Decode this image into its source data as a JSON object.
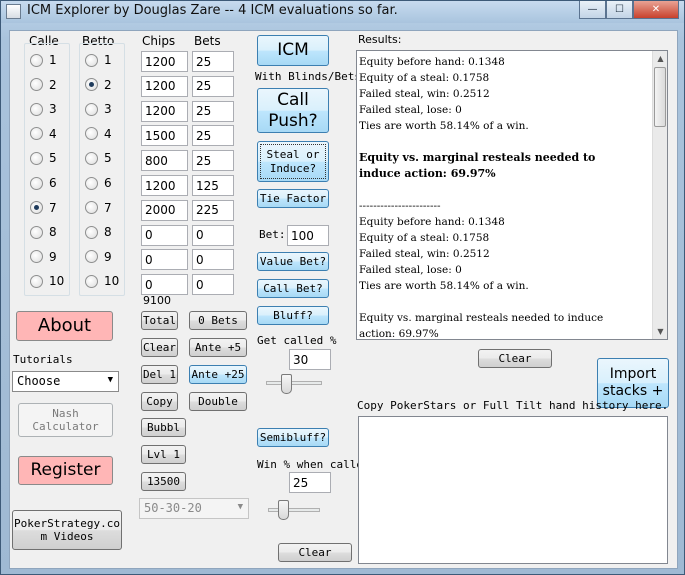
{
  "window": {
    "title": "ICM Explorer by Douglas Zare -- 4 ICM evaluations so far.",
    "controls": {
      "minimize": "—",
      "maximize": "☐",
      "close": "✕"
    }
  },
  "calle_header": "Calle",
  "betto_header": "Betto",
  "calle_options": [
    "1",
    "2",
    "3",
    "4",
    "5",
    "6",
    "7",
    "8",
    "9",
    "10"
  ],
  "calle_selected": "7",
  "betto_options": [
    "1",
    "2",
    "3",
    "4",
    "5",
    "6",
    "7",
    "8",
    "9",
    "10"
  ],
  "betto_selected": "2",
  "chips_header": "Chips",
  "bets_header": "Bets",
  "chips": [
    "1200",
    "1200",
    "1200",
    "1500",
    "800",
    "1200",
    "2000",
    "0",
    "0",
    "0"
  ],
  "bets": [
    "25",
    "25",
    "25",
    "25",
    "25",
    "125",
    "225",
    "0",
    "0",
    "0"
  ],
  "total_chips": "9100",
  "buttons": {
    "icm": "ICM",
    "with_blinds_label": "With Blinds/Bets:",
    "call_push_line1": "Call",
    "call_push_line2": "Push?",
    "steal_line1": "Steal or",
    "steal_line2": "Induce?",
    "tie_factor": "Tie Factor",
    "bet_label": "Bet:",
    "bet_value": "100",
    "value_bet": "Value Bet?",
    "call_bet": "Call Bet?",
    "bluff": "Bluff?",
    "get_called_label": "Get called %",
    "get_called_value": "30",
    "semibluff": "Semibluff?",
    "win_pct_label": "Win % when called",
    "win_pct_value": "25",
    "clear_bottom": "Clear",
    "total": "Total",
    "zero_bets": "0 Bets",
    "clear": "Clear",
    "ante5": "Ante +5",
    "del1": "Del 1",
    "ante25": "Ante +25",
    "copy": "Copy",
    "double": "Double",
    "bubbl": "Bubbl",
    "lvl1": "Lvl 1",
    "n13500": "13500",
    "payout_select": "50-30-20"
  },
  "left": {
    "about": "About",
    "tutorials_label": "Tutorials",
    "tutorials_select": "Choose",
    "nash_line1": "Nash",
    "nash_line2": "Calculator",
    "register": "Register",
    "poker_line1": "PokerStrategy.co",
    "poker_line2": "m Videos"
  },
  "results": {
    "label": "Results:",
    "lines": [
      {
        "text": "Equity before hand: 0.1348",
        "bold": false
      },
      {
        "text": "Equity of a steal: 0.1758",
        "bold": false
      },
      {
        "text": "Failed steal, win: 0.2512",
        "bold": false
      },
      {
        "text": "Failed steal, lose: 0",
        "bold": false
      },
      {
        "text": "Ties are worth 58.14% of a win.",
        "bold": false
      },
      {
        "text": "",
        "bold": false
      },
      {
        "text": "Equity vs. marginal resteals needed to",
        "bold": true
      },
      {
        "text": "induce action: 69.97%",
        "bold": true
      },
      {
        "text": "",
        "bold": false
      },
      {
        "text": " -----------------------",
        "bold": false
      },
      {
        "text": "Equity before hand: 0.1348",
        "bold": false
      },
      {
        "text": "Equity of a steal: 0.1758",
        "bold": false
      },
      {
        "text": "Failed steal, win: 0.2512",
        "bold": false
      },
      {
        "text": "Failed steal, lose: 0",
        "bold": false
      },
      {
        "text": "Ties are worth 58.14% of a win.",
        "bold": false
      },
      {
        "text": "",
        "bold": false
      },
      {
        "text": "Equity vs. marginal resteals needed to induce",
        "bold": false
      },
      {
        "text": "action: 69.97%",
        "bold": false
      }
    ],
    "clear": "Clear",
    "import_line1": "Import",
    "import_line2": "stacks +",
    "history_label": "Copy PokerStars or Full Tilt hand history here."
  }
}
